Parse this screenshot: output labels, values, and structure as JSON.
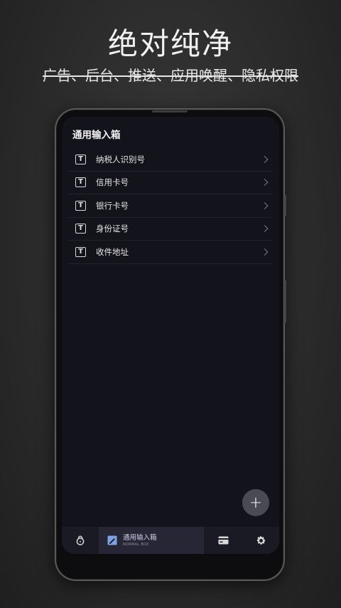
{
  "promo": {
    "headline": "绝对纯净",
    "subline": "广告、后台、推送、应用唤醒、隐私权限"
  },
  "app": {
    "title": "通用输入箱",
    "items": [
      {
        "label": "纳税人识别号",
        "icon": "text-T-icon"
      },
      {
        "label": "信用卡号",
        "icon": "text-T-icon"
      },
      {
        "label": "银行卡号",
        "icon": "text-T-icon"
      },
      {
        "label": "身份证号",
        "icon": "text-T-icon"
      },
      {
        "label": "收件地址",
        "icon": "text-T-icon"
      }
    ],
    "icon_glyph": "T",
    "fab_label": "+",
    "nav": {
      "active_label": "通用输入箱",
      "active_sub": "NORMAL BOX"
    }
  },
  "colors": {
    "screen_bg": "#13131c",
    "nav_bg": "#1a1a25",
    "active_tab_bg": "#262634",
    "accent": "#7ea2e6",
    "fab_bg": "#4a4a55"
  }
}
